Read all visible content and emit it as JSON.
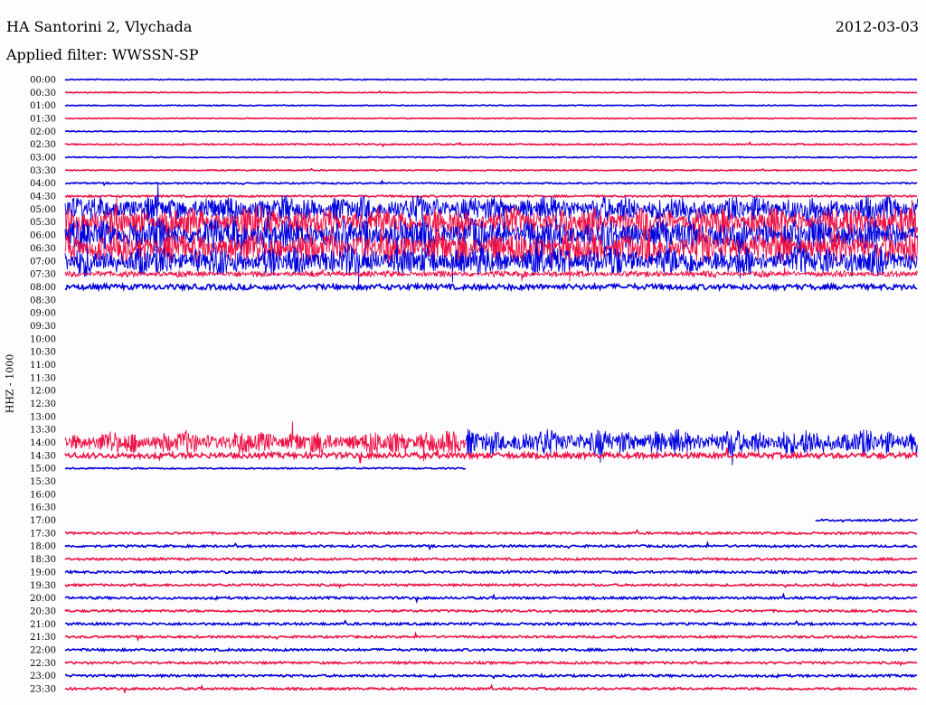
{
  "header": {
    "title": "HA Santorini 2, Vlychada",
    "subtitle": "Applied filter: WWSSN-SP",
    "date": "2012-03-03"
  },
  "chart_data": {
    "type": "line",
    "title": "HA Santorini 2, Vlychada",
    "ylabel": "HHZ - 1000",
    "xlabel": "",
    "colors": {
      "blue": "#0000dd",
      "red": "#ee1144"
    },
    "tick_labels": [
      "00:00",
      "00:30",
      "01:00",
      "01:30",
      "02:00",
      "02:30",
      "03:00",
      "03:30",
      "04:00",
      "04:30",
      "05:00",
      "05:30",
      "06:00",
      "06:30",
      "07:00",
      "07:30",
      "08:00",
      "08:30",
      "09:00",
      "09:30",
      "10:00",
      "10:30",
      "11:00",
      "11:30",
      "12:00",
      "12:30",
      "13:00",
      "13:30",
      "14:00",
      "14:30",
      "15:00",
      "15:30",
      "16:00",
      "16:30",
      "17:00",
      "17:30",
      "18:00",
      "18:30",
      "19:00",
      "19:30",
      "20:00",
      "20:30",
      "21:00",
      "21:30",
      "22:00",
      "22:30",
      "23:00",
      "23:30"
    ],
    "series": [
      {
        "start": "00:00",
        "color": "blue",
        "extent": [
          0,
          1
        ],
        "amplitude": 0.5
      },
      {
        "start": "00:30",
        "color": "red",
        "extent": [
          0,
          1
        ],
        "amplitude": 0.5
      },
      {
        "start": "01:00",
        "color": "blue",
        "extent": [
          0,
          1
        ],
        "amplitude": 0.5
      },
      {
        "start": "01:30",
        "color": "red",
        "extent": [
          0,
          1
        ],
        "amplitude": 0.5
      },
      {
        "start": "02:00",
        "color": "blue",
        "extent": [
          0,
          1
        ],
        "amplitude": 0.5
      },
      {
        "start": "02:30",
        "color": "red",
        "extent": [
          0,
          1
        ],
        "amplitude": 0.7
      },
      {
        "start": "03:00",
        "color": "blue",
        "extent": [
          0,
          1
        ],
        "amplitude": 0.6
      },
      {
        "start": "03:30",
        "color": "red",
        "extent": [
          0,
          1
        ],
        "amplitude": 0.6
      },
      {
        "start": "04:00",
        "color": "blue",
        "extent": [
          0,
          1
        ],
        "amplitude": 0.8
      },
      {
        "start": "04:30",
        "color": "red",
        "extent": [
          0,
          1
        ],
        "amplitude": 1.0
      },
      {
        "start": "05:00",
        "color": "blue",
        "extent": [
          0,
          1
        ],
        "amplitude": 16
      },
      {
        "start": "05:30",
        "color": "red",
        "extent": [
          0,
          1
        ],
        "amplitude": 18
      },
      {
        "start": "06:00",
        "color": "blue",
        "extent": [
          0,
          1
        ],
        "amplitude": 20
      },
      {
        "start": "06:30",
        "color": "red",
        "extent": [
          0,
          1
        ],
        "amplitude": 20
      },
      {
        "start": "07:00",
        "color": "blue",
        "extent": [
          0,
          1
        ],
        "amplitude": 18
      },
      {
        "start": "07:30",
        "color": "red",
        "extent": [
          0,
          1
        ],
        "amplitude": 4
      },
      {
        "start": "08:00",
        "color": "blue",
        "extent": [
          0,
          1
        ],
        "amplitude": 3
      },
      {
        "start": "14:00",
        "color": "red",
        "extent": [
          0,
          0.47
        ],
        "amplitude": 14
      },
      {
        "start": "14:00",
        "color": "blue",
        "extent": [
          0.47,
          1
        ],
        "amplitude": 16
      },
      {
        "start": "14:30",
        "color": "red",
        "extent": [
          0,
          1
        ],
        "amplitude": 3
      },
      {
        "start": "15:00",
        "color": "blue",
        "extent": [
          0,
          0.47
        ],
        "amplitude": 0.8
      },
      {
        "start": "17:00",
        "color": "blue",
        "extent": [
          0.88,
          1
        ],
        "amplitude": 1
      },
      {
        "start": "17:30",
        "color": "red",
        "extent": [
          0,
          1
        ],
        "amplitude": 1.2
      },
      {
        "start": "18:00",
        "color": "blue",
        "extent": [
          0,
          1
        ],
        "amplitude": 1.2
      },
      {
        "start": "18:30",
        "color": "red",
        "extent": [
          0,
          1
        ],
        "amplitude": 1.2
      },
      {
        "start": "19:00",
        "color": "blue",
        "extent": [
          0,
          1
        ],
        "amplitude": 1.3
      },
      {
        "start": "19:30",
        "color": "red",
        "extent": [
          0,
          1
        ],
        "amplitude": 1.2
      },
      {
        "start": "20:00",
        "color": "blue",
        "extent": [
          0,
          1
        ],
        "amplitude": 1.3
      },
      {
        "start": "20:30",
        "color": "red",
        "extent": [
          0,
          1
        ],
        "amplitude": 1.2
      },
      {
        "start": "21:00",
        "color": "blue",
        "extent": [
          0,
          1
        ],
        "amplitude": 1.3
      },
      {
        "start": "21:30",
        "color": "red",
        "extent": [
          0,
          1
        ],
        "amplitude": 1.2
      },
      {
        "start": "22:00",
        "color": "blue",
        "extent": [
          0,
          1
        ],
        "amplitude": 1.3
      },
      {
        "start": "22:30",
        "color": "red",
        "extent": [
          0,
          1
        ],
        "amplitude": 1.2
      },
      {
        "start": "23:00",
        "color": "blue",
        "extent": [
          0,
          1
        ],
        "amplitude": 1.3
      },
      {
        "start": "23:30",
        "color": "red",
        "extent": [
          0,
          1
        ],
        "amplitude": 1.2
      }
    ]
  }
}
